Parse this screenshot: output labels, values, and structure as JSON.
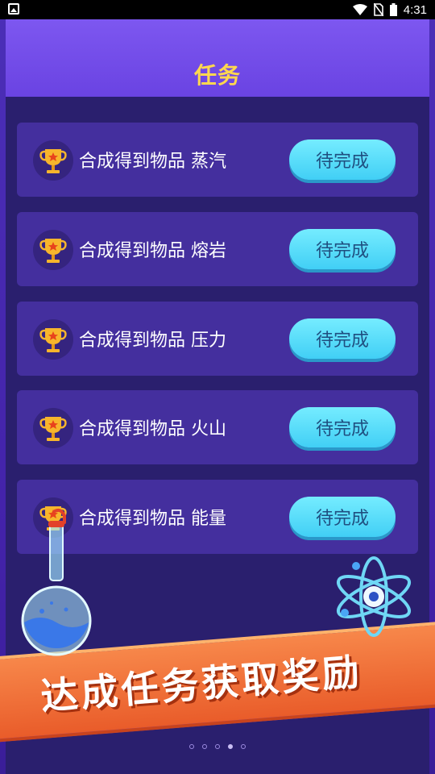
{
  "status_bar": {
    "time": "4:31",
    "icons": [
      "gallery-icon",
      "wifi-icon",
      "no-sim-icon",
      "battery-icon"
    ]
  },
  "header": {
    "title": "任务"
  },
  "tasks": [
    {
      "label": "合成得到物品 蒸汽",
      "button": "待完成"
    },
    {
      "label": "合成得到物品 熔岩",
      "button": "待完成"
    },
    {
      "label": "合成得到物品 压力",
      "button": "待完成"
    },
    {
      "label": "合成得到物品 火山",
      "button": "待完成"
    },
    {
      "label": "合成得到物品 能量",
      "button": "待完成"
    }
  ],
  "banner": {
    "slogan": "达成任务获取奖励"
  },
  "pager": {
    "count": 5,
    "active_index": 3
  },
  "colors": {
    "title": "#ffd84e",
    "button": "#4fd8f7",
    "banner": "#ef6f36",
    "card": "#442f9e"
  }
}
